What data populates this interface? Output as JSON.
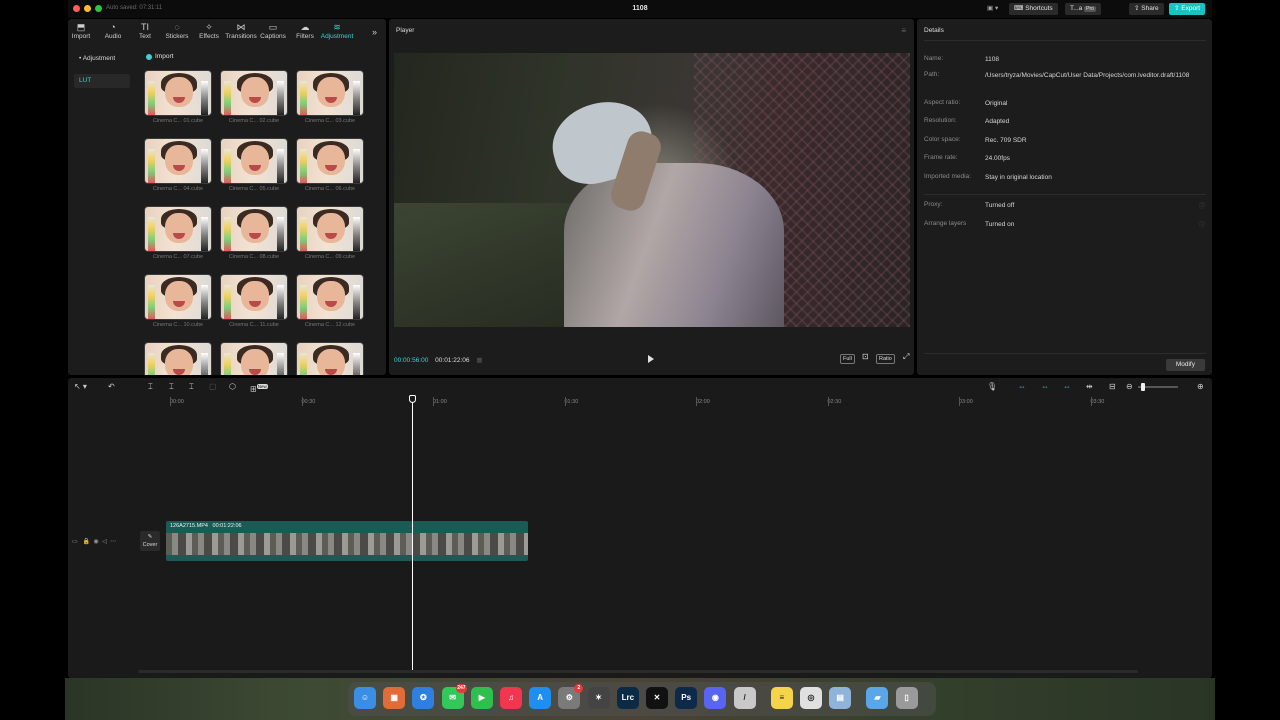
{
  "window": {
    "title": "1108",
    "autosave": "Auto saved: 07:31:11",
    "shortcuts": "Shortcuts",
    "team": "T...a",
    "pro_badge": "Pro",
    "share": "Share",
    "export": "Export"
  },
  "media_tabs": [
    {
      "label": "Import",
      "icon": "⬒",
      "icon_name": "import-icon"
    },
    {
      "label": "Audio",
      "icon": "◔",
      "icon_name": "audio-icon"
    },
    {
      "label": "Text",
      "icon": "TI",
      "icon_name": "text-icon"
    },
    {
      "label": "Stickers",
      "icon": "◌",
      "icon_name": "stickers-icon"
    },
    {
      "label": "Effects",
      "icon": "✧",
      "icon_name": "effects-icon"
    },
    {
      "label": "Transitions",
      "icon": "⋈",
      "icon_name": "transitions-icon"
    },
    {
      "label": "Captions",
      "icon": "▭",
      "icon_name": "captions-icon"
    },
    {
      "label": "Filters",
      "icon": "☁",
      "icon_name": "filters-icon"
    },
    {
      "label": "Adjustment",
      "icon": "≋",
      "icon_name": "adjustment-icon"
    }
  ],
  "media_active_tab": "Adjustment",
  "media_sidebar": {
    "adjustment": "• Adjustment",
    "lut": "LUT"
  },
  "import_button": "Import",
  "luts": [
    "Cinema C... 01.cube",
    "Cinema C... 02.cube",
    "Cinema C... 03.cube",
    "Cinema C... 04.cube",
    "Cinema C... 05.cube",
    "Cinema C... 06.cube",
    "Cinema C... 07.cube",
    "Cinema C... 08.cube",
    "Cinema C... 09.cube",
    "Cinema C... 10.cube",
    "Cinema C... 11.cube",
    "Cinema C... 12.cube",
    "",
    "",
    ""
  ],
  "player": {
    "title": "Player",
    "current_time": "00:00:56:00",
    "total_time": "00:01:22:06",
    "full": "Full",
    "ratio": "Ratio"
  },
  "details": {
    "title": "Details",
    "rows": [
      {
        "key": "Name:",
        "value": "1108"
      },
      {
        "key": "Path:",
        "value": "/Users/tryza/Movies/CapCut/User Data/Projects/com.lveditor.draft/1108"
      },
      {
        "key": "Aspect ratio:",
        "value": "Original"
      },
      {
        "key": "Resolution:",
        "value": "Adapted"
      },
      {
        "key": "Color space:",
        "value": "Rec. 709 SDR"
      },
      {
        "key": "Frame rate:",
        "value": "24.00fps"
      },
      {
        "key": "Imported media:",
        "value": "Stay in original location"
      },
      {
        "key": "Proxy:",
        "value": "Turned off"
      },
      {
        "key": "Arrange layers",
        "value": "Turned on"
      }
    ],
    "modify": "Modify"
  },
  "timeline": {
    "ruler": [
      "00:00",
      "00:30",
      "01:00",
      "01:30",
      "02:00",
      "02:30",
      "03:00",
      "03:30"
    ],
    "clip_name": "126A2715.MP4",
    "clip_duration": "00:01:22:06",
    "cover": "Cover",
    "new_badge": "New"
  },
  "dock": [
    {
      "name": "finder-icon",
      "color": "#3a8ee6",
      "glyph": "☺"
    },
    {
      "name": "launchpad-icon",
      "color": "#e26b3a",
      "glyph": "▦"
    },
    {
      "name": "safari-icon",
      "color": "#2f7fe0",
      "glyph": "✪"
    },
    {
      "name": "messages-icon",
      "color": "#34c759",
      "glyph": "✉",
      "badge": "247"
    },
    {
      "name": "facetime-icon",
      "color": "#2fbf4f",
      "glyph": "▶"
    },
    {
      "name": "music-icon",
      "color": "#f3364f",
      "glyph": "♫"
    },
    {
      "name": "app-store-icon",
      "color": "#1f8ef1",
      "glyph": "A"
    },
    {
      "name": "system-settings-icon",
      "color": "#7a7a7a",
      "glyph": "⚙",
      "badge": "2"
    },
    {
      "name": "final-cut-icon",
      "color": "#444",
      "glyph": "✶"
    },
    {
      "name": "lightroom-icon",
      "color": "#0b2a45",
      "glyph": "Lrc"
    },
    {
      "name": "capcut-icon",
      "color": "#111",
      "glyph": "✕"
    },
    {
      "name": "photoshop-icon",
      "color": "#0d2a4a",
      "glyph": "Ps"
    },
    {
      "name": "discord-icon",
      "color": "#5865f2",
      "glyph": "◉"
    },
    {
      "name": "pen-app-icon",
      "color": "#c9c9c9",
      "glyph": "/"
    },
    {
      "name": "notes-icon",
      "color": "#f5d34b",
      "glyph": "≡"
    },
    {
      "name": "quicktime-icon",
      "color": "#e0e0e0",
      "glyph": "◎"
    },
    {
      "name": "preview-icon",
      "color": "#8fb3d9",
      "glyph": "▤"
    },
    {
      "name": "downloads-folder-icon",
      "color": "#59a7e8",
      "glyph": "▰"
    },
    {
      "name": "trash-icon",
      "color": "#9a9a9a",
      "glyph": "▯"
    }
  ],
  "colors": {
    "accent": "#3fd1d1",
    "clip": "#1a5b56",
    "export": "#17c3c3"
  }
}
